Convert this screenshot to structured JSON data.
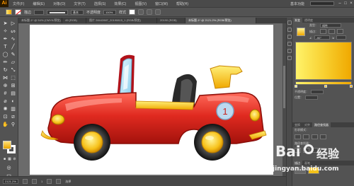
{
  "app": {
    "logo": "Ai"
  },
  "menu": [
    "文件(F)",
    "编辑(E)",
    "对象(O)",
    "文字(T)",
    "选择(S)",
    "效果(C)",
    "视图(V)",
    "窗口(W)",
    "帮助(H)"
  ],
  "workspace": "基本功能",
  "search_placeholder": "",
  "window_controls": [
    "–",
    "□",
    "×"
  ],
  "control_bar": {
    "stroke_label": "描边",
    "stroke_value": "",
    "weight_value": "基本",
    "opacity_label": "不透明度",
    "opacity_value": "100%",
    "style_label": "样式"
  },
  "tabs": [
    {
      "label": "未标题-1* @ 54% (CMYK/预览)",
      "active": false
    },
    {
      "label": "49 (RGB)",
      "active": false
    },
    {
      "label": "图片 28442887_20190815_1 (RGB/预览)",
      "active": false
    },
    {
      "label": "20190 (RGB)",
      "active": false
    },
    {
      "label": "未标题-1* @ 2121.2% (RGB/预览)",
      "active": true
    }
  ],
  "status": {
    "zoom": "2121.2%",
    "page": "1",
    "tool_name": "选择"
  },
  "panels": {
    "gradient": {
      "tabs": [
        "渐变",
        "透明度"
      ],
      "type_label": "类型：",
      "type_value": "线性",
      "stroke_label": "描边：",
      "angle_value": "-90°",
      "ratio_value": "",
      "opacity_label": "不透明度：",
      "position_label": "位置："
    },
    "pathfinder": {
      "tabs": [
        "变换",
        "对齐",
        "路径查找器"
      ],
      "shape_modes_label": "形状模式：",
      "pathfinders_label": "路径查找器："
    },
    "stroke": {
      "tabs": [
        "描边",
        "画笔"
      ]
    }
  },
  "artwork": {
    "badge_number": "1"
  },
  "watermark": {
    "text_1": "Bai",
    "text_2": "经验",
    "url": "jingyan.baidu.com"
  },
  "colors": {
    "car_red": "#e02a20",
    "car_yellow": "#f7c21a",
    "ui_bg": "#535353"
  }
}
